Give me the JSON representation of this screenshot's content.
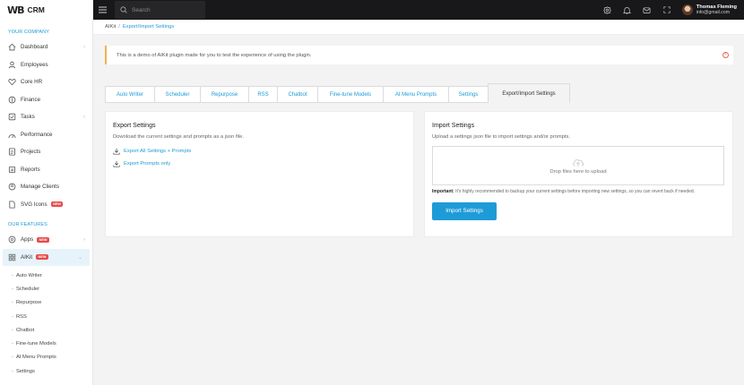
{
  "brand": {
    "logo": "WB",
    "name": "CRM"
  },
  "sidebar": {
    "section1": "YOUR COMPANY",
    "items1": [
      {
        "label": "Dashboard",
        "icon": "home-icon",
        "chevron": true
      },
      {
        "label": "Employees",
        "icon": "user-icon"
      },
      {
        "label": "Core HR",
        "icon": "heart-icon"
      },
      {
        "label": "Finance",
        "icon": "finance-icon"
      },
      {
        "label": "Tasks",
        "icon": "tasks-icon",
        "chevron": true
      },
      {
        "label": "Performance",
        "icon": "performance-icon"
      },
      {
        "label": "Projects",
        "icon": "projects-icon"
      },
      {
        "label": "Reports",
        "icon": "reports-icon"
      },
      {
        "label": "Manage Clients",
        "icon": "clients-icon"
      },
      {
        "label": "SVG Icons",
        "icon": "svg-icons-icon",
        "badge": "NEW"
      }
    ],
    "section2": "OUR FEATURES",
    "apps": {
      "label": "Apps",
      "badge": "NEW"
    },
    "aikit": {
      "label": "AIKit",
      "badge": "NEW"
    },
    "subitems": [
      "Auto Writer",
      "Scheduler",
      "Repurpose",
      "RSS",
      "Chatbot",
      "Fine-tune Models",
      "AI Menu Prompts",
      "Settings"
    ],
    "dash": "-"
  },
  "topbar": {
    "search_placeholder": "Search",
    "user_name": "Thomas Fleming",
    "user_email": "info@gmail.com"
  },
  "breadcrumb": {
    "root": "AIKit",
    "sep": "/",
    "current": "Export/Import Settings"
  },
  "alert": {
    "text": "This is a demo of AIKit plugin made for you to test the experience of using the plugin."
  },
  "tabs": [
    "Auto Writer",
    "Scheduler",
    "Repurpose",
    "RSS",
    "Chatbot",
    "Fine-tune Models",
    "AI Menu Prompts",
    "Settings",
    "Export/Import Settings"
  ],
  "export": {
    "title": "Export Settings",
    "description": "Download the current settings and prompts as a json file.",
    "link_all": "Export All Settings + Prompts",
    "link_prompts": "Export Prompts only"
  },
  "import": {
    "title": "Import Settings",
    "description": "Upload a settings json file to import settings and/or prompts.",
    "dropzone": "Drop files here to upload",
    "note_label": "Important:",
    "note_text": " It's highly recommended to backup your current settings before importing new settings, so you can revert back if needed.",
    "button": "Import Settings"
  },
  "colors": {
    "accent": "#1e9bd7",
    "topbar": "#18181a",
    "badge": "#e84a4a",
    "alert_border": "#f0b34a"
  }
}
